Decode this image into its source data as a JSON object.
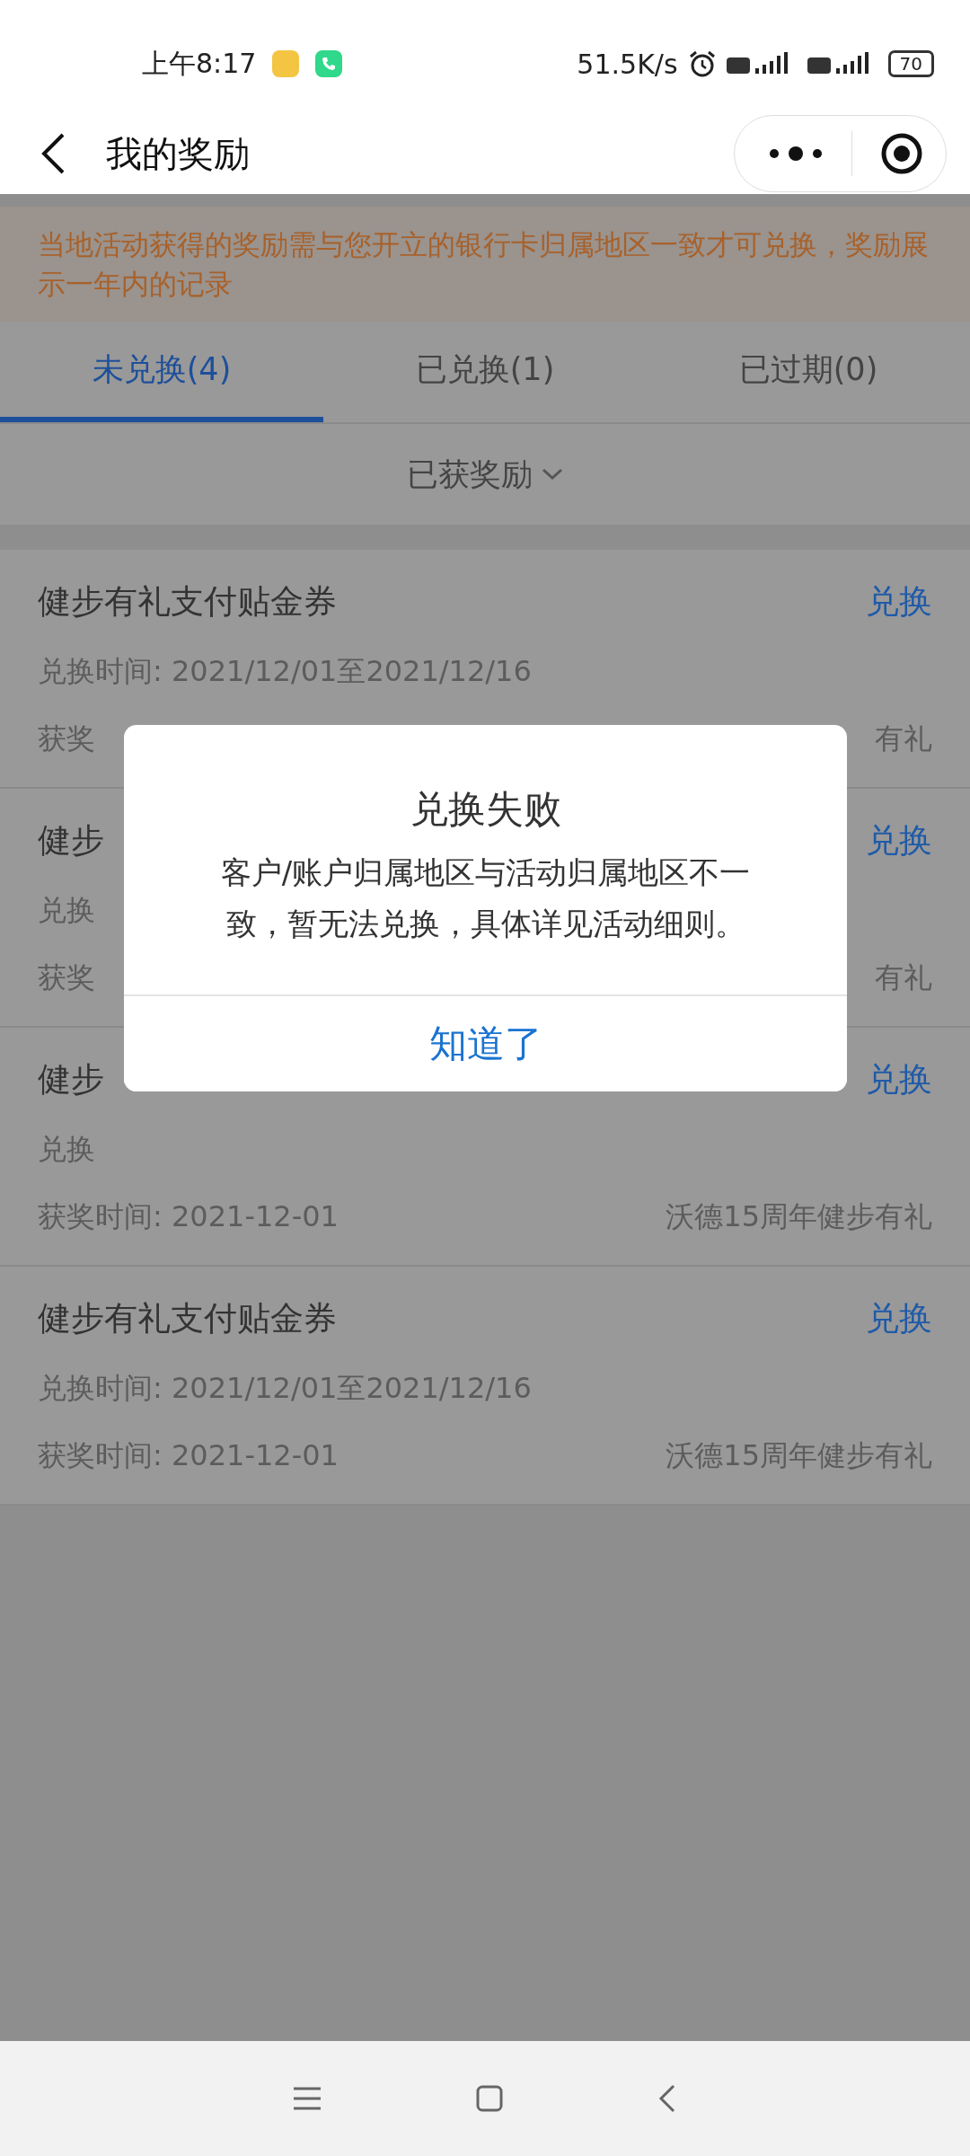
{
  "status_bar": {
    "time": "上午8:17",
    "net_speed": "51.5K/s",
    "battery": "70"
  },
  "nav": {
    "title": "我的奖励"
  },
  "notice": "当地活动获得的奖励需与您开立的银行卡归属地区一致才可兑换，奖励展示一年内的记录",
  "tabs": [
    {
      "label": "未兑换(4)",
      "selected": true
    },
    {
      "label": "已兑换(1)",
      "selected": false
    },
    {
      "label": "已过期(0)",
      "selected": false
    }
  ],
  "filter": {
    "label": "已获奖励"
  },
  "rewards": [
    {
      "title": "健步有礼支付贴金券",
      "action": "兑换",
      "exchange_time": "兑换时间: 2021/12/01至2021/12/16",
      "award_time": "获奖",
      "activity": "有礼"
    },
    {
      "title": "健步",
      "action": "兑换",
      "exchange_time": "兑换",
      "award_time": "获奖",
      "activity": "有礼"
    },
    {
      "title": "健步",
      "action": "兑换",
      "exchange_time": "兑换",
      "award_time": "获奖时间: 2021-12-01",
      "activity": "沃德15周年健步有礼"
    },
    {
      "title": "健步有礼支付贴金券",
      "action": "兑换",
      "exchange_time": "兑换时间: 2021/12/01至2021/12/16",
      "award_time": "获奖时间: 2021-12-01",
      "activity": "沃德15周年健步有礼"
    }
  ],
  "dialog": {
    "title": "兑换失败",
    "message": "客户/账户归属地区与活动归属地区不一致，暂无法兑换，具体详见活动细则。",
    "button": "知道了"
  }
}
